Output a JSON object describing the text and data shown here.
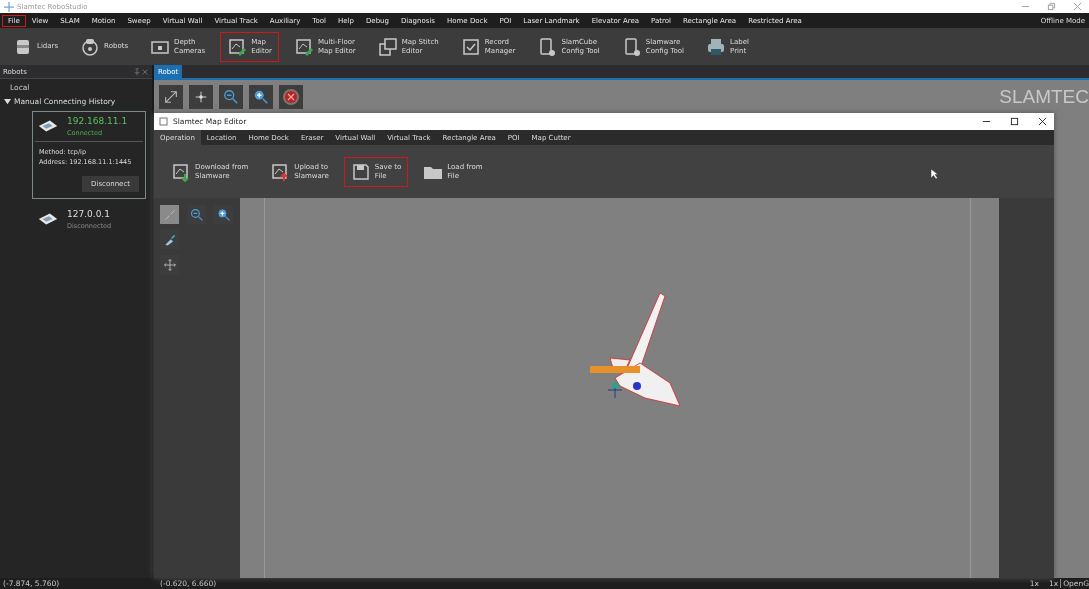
{
  "window": {
    "title": "Slamtec RoboStudio"
  },
  "menu": [
    {
      "label": "File",
      "highlighted": true
    },
    {
      "label": "View",
      "highlighted": false
    },
    {
      "label": "SLAM",
      "highlighted": false
    },
    {
      "label": "Motion",
      "highlighted": false
    },
    {
      "label": "Sweep",
      "highlighted": false
    },
    {
      "label": "Virtual Wall",
      "highlighted": false
    },
    {
      "label": "Virtual Track",
      "highlighted": false
    },
    {
      "label": "Auxiliary",
      "highlighted": false
    },
    {
      "label": "Tool",
      "highlighted": false
    },
    {
      "label": "Help",
      "highlighted": false
    },
    {
      "label": "Debug",
      "highlighted": false
    },
    {
      "label": "Diagnosis",
      "highlighted": false
    },
    {
      "label": "Home Dock",
      "highlighted": false
    },
    {
      "label": "POI",
      "highlighted": false
    },
    {
      "label": "Laser Landmark",
      "highlighted": false
    },
    {
      "label": "Elevator Area",
      "highlighted": false
    },
    {
      "label": "Patrol",
      "highlighted": false
    },
    {
      "label": "Rectangle Area",
      "highlighted": false
    },
    {
      "label": "Restricted Area",
      "highlighted": false
    }
  ],
  "mode": "Offline Mode",
  "toolbar": [
    {
      "kind": "lidar",
      "lines": [
        "Lidars"
      ],
      "highlighted": false
    },
    {
      "kind": "robot",
      "lines": [
        "Robots"
      ],
      "highlighted": false
    },
    {
      "kind": "camera",
      "lines": [
        "Depth",
        "Cameras"
      ],
      "highlighted": false
    },
    {
      "kind": "map",
      "lines": [
        "Map",
        "Editor"
      ],
      "highlighted": true
    },
    {
      "kind": "map",
      "lines": [
        "Multi-Floor",
        "Map Editor"
      ],
      "highlighted": false
    },
    {
      "kind": "stitch",
      "lines": [
        "Map Stitch",
        "Editor"
      ],
      "highlighted": false
    },
    {
      "kind": "record",
      "lines": [
        "Record",
        "Manager"
      ],
      "highlighted": false
    },
    {
      "kind": "device",
      "lines": [
        "SlamCube",
        "Config Tool"
      ],
      "highlighted": false
    },
    {
      "kind": "device",
      "lines": [
        "Slamware",
        "Config Tool"
      ],
      "highlighted": false
    },
    {
      "kind": "printer",
      "lines": [
        "Label",
        "Print"
      ],
      "highlighted": false
    }
  ],
  "robots_panel": {
    "title": "Robots",
    "local": "Local",
    "group": "Manual Connecting History",
    "expanded": true,
    "items": [
      {
        "address": "192.168.11.1",
        "status": "Connected",
        "connected": true,
        "selected": true,
        "method": "Method: tcp/ip",
        "detail_address": "Address: 192.168.11.1:1445",
        "action": "Disconnect"
      },
      {
        "address": "127.0.0.1",
        "status": "Disconnected",
        "connected": false,
        "selected": false
      }
    ]
  },
  "document_tab": {
    "label": "Robot",
    "selected": true
  },
  "logo": "SLAMTEC",
  "map_editor": {
    "title": "Slamtec Map Editor",
    "tabs": [
      {
        "label": "Operation",
        "selected": true
      },
      {
        "label": "Location",
        "selected": false
      },
      {
        "label": "Home Dock",
        "selected": false
      },
      {
        "label": "Eraser",
        "selected": false
      },
      {
        "label": "Virtual Wall",
        "selected": false
      },
      {
        "label": "Virtual Track",
        "selected": false
      },
      {
        "label": "Rectangle Area",
        "selected": false
      },
      {
        "label": "POI",
        "selected": false
      },
      {
        "label": "Map Cutter",
        "selected": false
      }
    ],
    "actions": [
      {
        "kind": "download",
        "lines": [
          "Download from",
          "Slamware"
        ],
        "highlighted": false
      },
      {
        "kind": "upload",
        "lines": [
          "Upload to",
          "Slamware"
        ],
        "highlighted": false
      },
      {
        "kind": "save",
        "lines": [
          "Save to",
          "File"
        ],
        "highlighted": true
      },
      {
        "kind": "folder",
        "lines": [
          "Load from",
          "File"
        ],
        "highlighted": false
      }
    ]
  },
  "status_bar": {
    "left": "(-7.874, 5.760)",
    "center": "(-0.620, 6.660)",
    "zoom": "1x",
    "zoom_2": "1x",
    "renderer": "OpenG"
  }
}
